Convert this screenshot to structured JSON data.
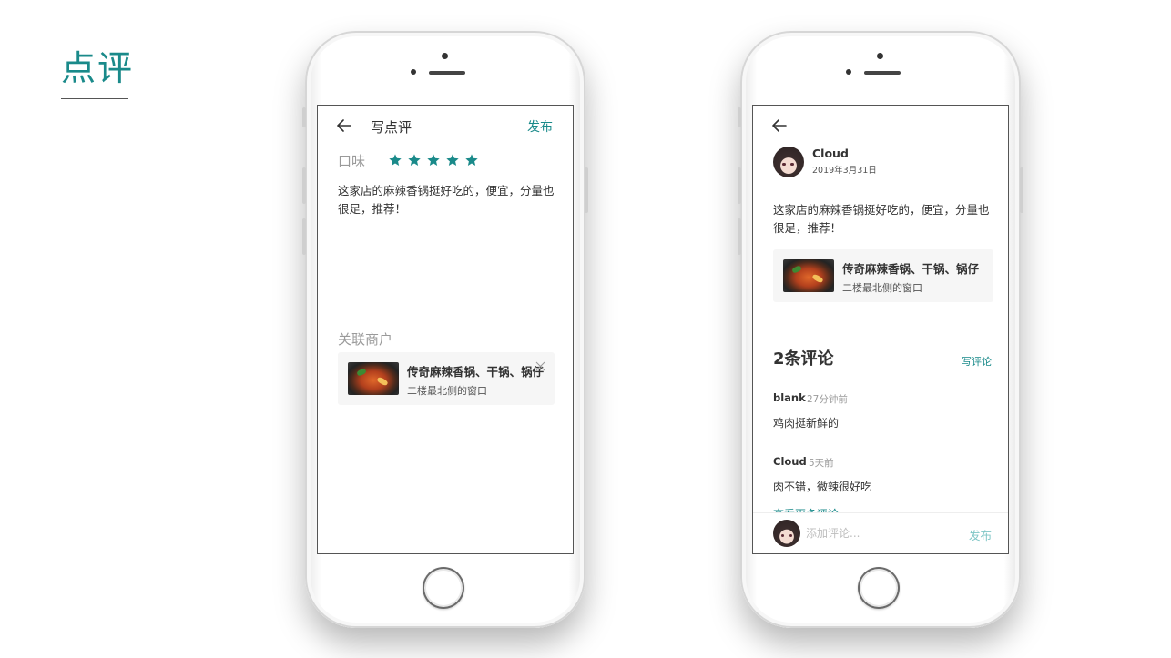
{
  "page": {
    "title": "点评"
  },
  "colors": {
    "accent": "#1a8a8a",
    "muted": "#9a9a9a",
    "card_bg": "#f6f6f6"
  },
  "write_review": {
    "nav_title": "写点评",
    "publish_label": "发布",
    "rating_label": "口味",
    "rating": 5,
    "rating_max": 5,
    "review_text": "这家店的麻辣香锅挺好吃的，便宜，分量也很足，推荐！",
    "associated_label": "关联商户",
    "merchant": {
      "name": "传奇麻辣香锅、干锅、锅仔",
      "location": "二楼最北侧的窗口"
    }
  },
  "review_detail": {
    "user_name": "Cloud",
    "date": "2019年3月31日",
    "review_text": "这家店的麻辣香锅挺好吃的，便宜，分量也很足，推荐！",
    "merchant": {
      "name": "传奇麻辣香锅、干锅、锅仔",
      "location": "二楼最北侧的窗口"
    },
    "comments_title": "2条评论",
    "write_comment_label": "写评论",
    "comments": [
      {
        "user": "blank",
        "time": "27分钟前",
        "text": "鸡肉挺新鲜的"
      },
      {
        "user": "Cloud",
        "time": "5天前",
        "text": "肉不错，微辣很好吃"
      }
    ],
    "more_comments_label": "查看更多评论",
    "comment_placeholder": "添加评论...",
    "comment_publish_label": "发布"
  }
}
